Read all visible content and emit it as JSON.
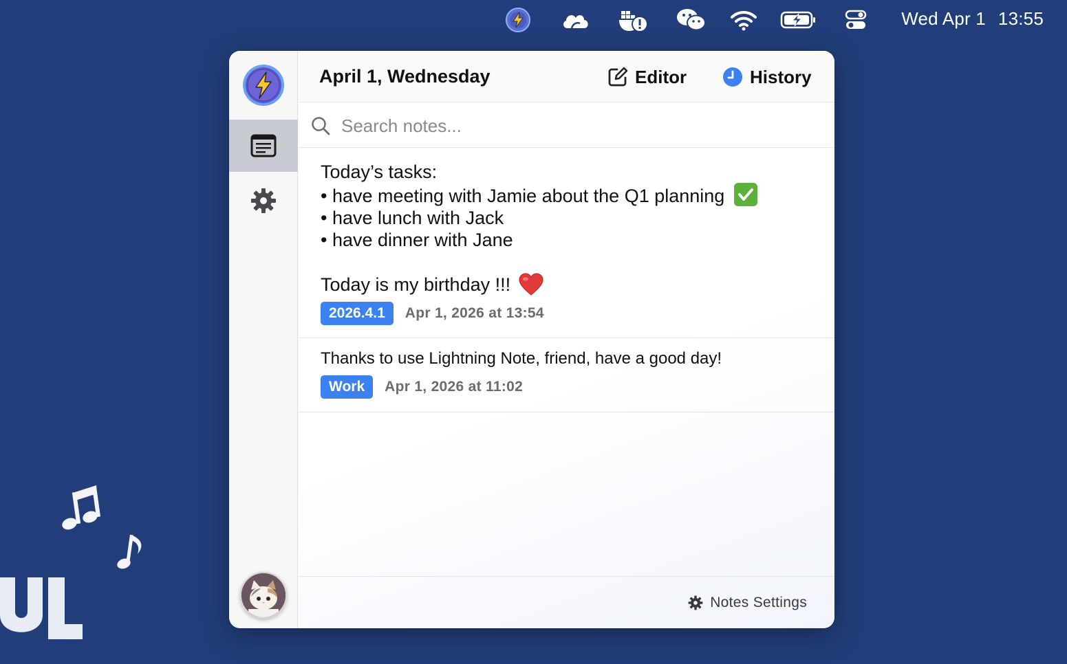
{
  "menubar": {
    "icons": [
      "lightning-app-icon",
      "cloud-icon",
      "docker-alert-icon",
      "wechat-icon",
      "wifi-icon",
      "battery-charging-icon",
      "control-center-icon"
    ],
    "clock_day": "Wed Apr 1",
    "clock_time": "13:55"
  },
  "sidebar": {
    "items": [
      {
        "name": "notes",
        "icon": "notes-list-icon",
        "active": true
      },
      {
        "name": "settings",
        "icon": "gear-icon",
        "active": false
      }
    ]
  },
  "header": {
    "date_title": "April 1, Wednesday",
    "editor_label": "Editor",
    "history_label": "History"
  },
  "search": {
    "placeholder": "Search notes...",
    "value": ""
  },
  "notes": [
    {
      "lines": [
        "Today’s tasks:",
        "• have meeting with Jamie about the Q1 planning",
        "• have lunch with Jack",
        "• have dinner with Jane",
        "",
        "Today is my birthday !!!"
      ],
      "emojis": [
        "✅",
        "❤️"
      ],
      "tag": "2026.4.1",
      "timestamp": "Apr 1, 2026 at 13:54"
    },
    {
      "lines": [
        "Thanks to use Lightning Note, friend, have a good day!"
      ],
      "tag": "Work",
      "timestamp": "Apr 1, 2026 at 11:02"
    }
  ],
  "footer": {
    "notes_settings_label": "Notes Settings"
  },
  "colors": {
    "desktop": "#223e7a",
    "accent": "#3b82f0",
    "active_nav": "#c9cbd3"
  }
}
